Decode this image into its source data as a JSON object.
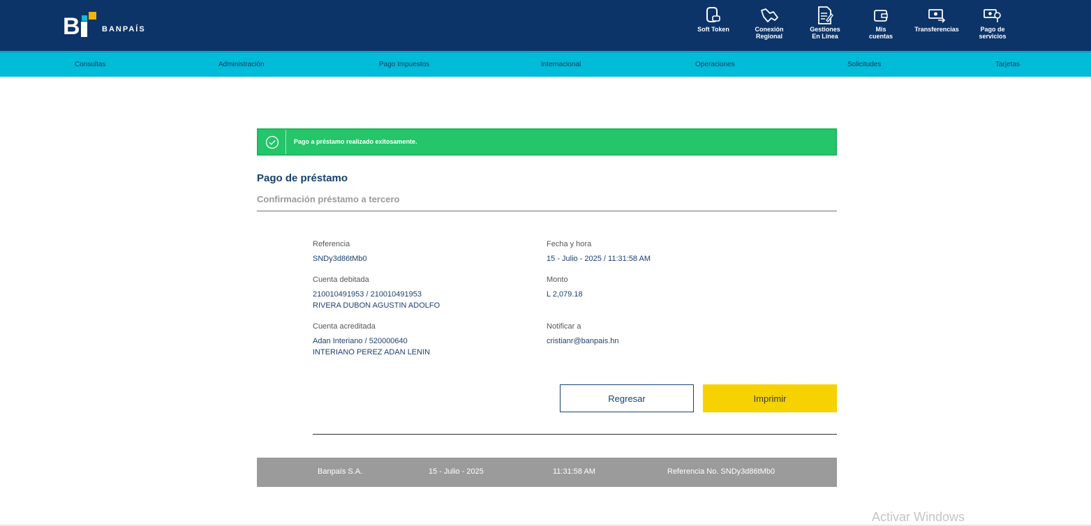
{
  "brand": {
    "name": "BANPAÍS"
  },
  "top_nav": [
    {
      "label": "Soft Token",
      "icon": "phone-token-icon"
    },
    {
      "label": "Conexión\nRegional",
      "icon": "handshake-icon"
    },
    {
      "label": "Gestiones\nEn Línea",
      "icon": "document-edit-icon"
    },
    {
      "label": "Mis\ncuentas",
      "icon": "wallet-icon"
    },
    {
      "label": "Transferencias",
      "icon": "money-transfer-icon"
    },
    {
      "label": "Pago de\nservicios",
      "icon": "bill-payment-icon"
    }
  ],
  "sub_nav": [
    "Consultas",
    "Administración",
    "Pago Impuestos",
    "Internacional",
    "Operaciones",
    "Solicitudes",
    "Tarjetas"
  ],
  "alert": {
    "message": "Pago a préstamo realizado exitosamente."
  },
  "page": {
    "title": "Pago de préstamo",
    "subtitle": "Confirmación préstamo a tercero"
  },
  "details": {
    "referencia": {
      "label": "Referencia",
      "value": "SNDy3d86tMb0"
    },
    "fecha_hora": {
      "label": "Fecha y hora",
      "value": "15 - Julio - 2025 / 11:31:58 AM"
    },
    "cuenta_debitada": {
      "label": "Cuenta debitada",
      "line1": "210010491953 / 210010491953",
      "line2": "RIVERA DUBON AGUSTIN ADOLFO"
    },
    "monto": {
      "label": "Monto",
      "value": "L 2,079.18"
    },
    "cuenta_acreditada": {
      "label": "Cuenta acreditada",
      "line1": "Adan Interiano / 520000640",
      "line2": "INTERIANO PEREZ ADAN LENIN"
    },
    "notificar": {
      "label": "Notificar a",
      "value": "cristianr@banpais.hn"
    }
  },
  "buttons": {
    "back": "Regresar",
    "print": "Imprimir"
  },
  "footer": {
    "company": "Banpaís S.A.",
    "date": "15 - Julio - 2025",
    "time": "11:31:58 AM",
    "reference": "Referencia No. SNDy3d86tMb0"
  },
  "watermark": "Activar Windows",
  "colors": {
    "header": "#0d3468",
    "subnav": "#00bcd8",
    "success": "#25c56a",
    "primary_button": "#f5d200",
    "footer_bar": "#9b9b9b"
  }
}
